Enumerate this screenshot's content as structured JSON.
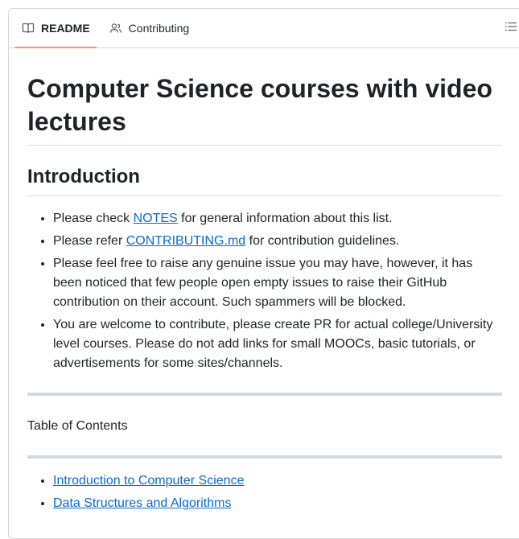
{
  "tabs": [
    {
      "label": "README",
      "icon": "book-icon"
    },
    {
      "label": "Contributing",
      "icon": "people-icon"
    }
  ],
  "outline_icon": "list-icon",
  "title": "Computer Science courses with video lectures",
  "intro_heading": "Introduction",
  "intro_items": {
    "i0": {
      "pre": "Please check ",
      "link": "NOTES",
      "post": " for general information about this list."
    },
    "i1": {
      "pre": "Please refer ",
      "link": "CONTRIBUTING.md",
      "post": " for contribution guidelines."
    },
    "i2": {
      "text": "Please feel free to raise any genuine issue you may have, however, it has been noticed that few people open empty issues to raise their GitHub contribution on their account. Such spammers will be blocked."
    },
    "i3": {
      "text": "You are welcome to contribute, please create PR for actual college/University level courses. Please do not add links for small MOOCs, basic tutorials, or advertisements for some sites/channels."
    }
  },
  "toc_label": "Table of Contents",
  "toc_items": [
    "Introduction to Computer Science",
    "Data Structures and Algorithms"
  ]
}
